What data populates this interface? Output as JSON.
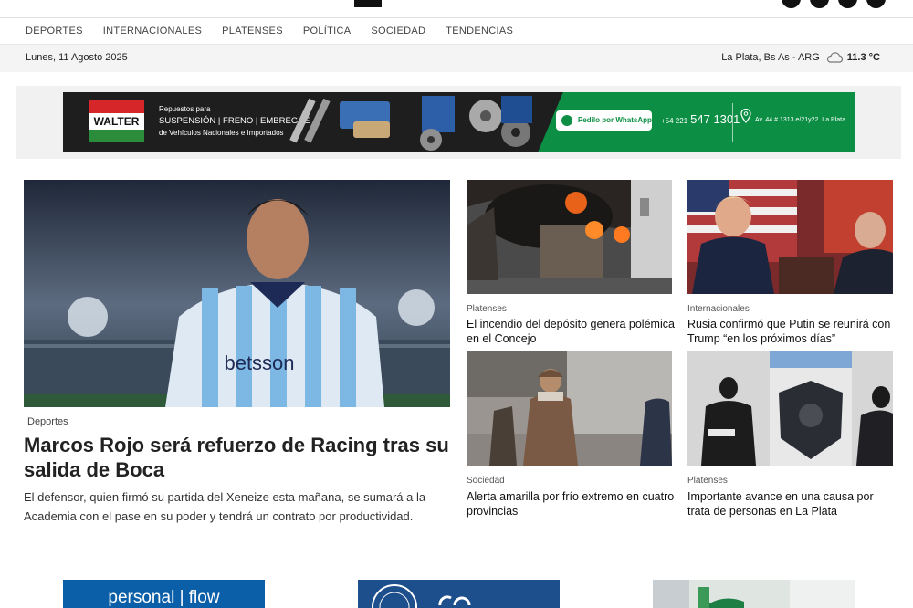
{
  "nav": {
    "items": [
      "DEPORTES",
      "INTERNACIONALES",
      "PLATENSES",
      "POLÍTICA",
      "SOCIEDAD",
      "TENDENCIAS"
    ]
  },
  "datebar": {
    "date": "Lunes, 11 Agosto 2025",
    "location": "La Plata, Bs As - ARG",
    "temperature": "11.3 °C"
  },
  "ad": {
    "brand": "WALTER",
    "line1": "Repuestos para",
    "line2": "SUSPENSIÓN | FRENO | EMBREGUE",
    "line3": "de Vehículos Nacionales e Importados",
    "whatsapp": "Pedilo por WhatsApp",
    "phone_prefix": "+54 221",
    "phone": "547 1301",
    "address": "Av. 44 # 1313 e/21y22. La Plata",
    "colors": {
      "green": "#0c8f44",
      "red": "#d7262a"
    }
  },
  "lead": {
    "category": "Deportes",
    "title": "Marcos Rojo será refuerzo de Racing tras su salida de Boca",
    "description": "El defensor, quien firmó su partida del Xeneize esta mañana, se sumará a la Academia con el pase en su poder y tendrá un contrato por productividad.",
    "image_text": "betsson"
  },
  "cards": [
    {
      "category": "Platenses",
      "title": "El incendio del depósito genera polémica en el Concejo"
    },
    {
      "category": "Internacionales",
      "title": "Rusia confirmó que Putin se reunirá con Trump “en los próximos días”"
    },
    {
      "category": "Sociedad",
      "title": "Alerta amarilla por frío extremo en cuatro provincias"
    },
    {
      "category": "Platenses",
      "title": "Importante avance en una causa por trata de personas en La Plata"
    }
  ],
  "bottom_ads": {
    "ad1_text": "personal | flow"
  }
}
